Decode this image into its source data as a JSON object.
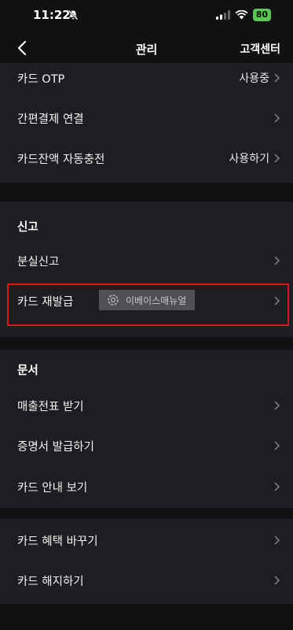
{
  "status": {
    "time": "11:22",
    "battery": "80"
  },
  "nav": {
    "title": "관리",
    "help": "고객센터"
  },
  "section1": [
    {
      "label": "카드 OTP",
      "value": "사용중"
    },
    {
      "label": "간편결제 연결",
      "value": ""
    },
    {
      "label": "카드잔액 자동충전",
      "value": "사용하기"
    }
  ],
  "report": {
    "title": "신고",
    "items": [
      {
        "label": "분실신고"
      },
      {
        "label": "카드 재발급"
      }
    ]
  },
  "documents": {
    "title": "문서",
    "items": [
      {
        "label": "매출전표 받기"
      },
      {
        "label": "증명서 발급하기"
      },
      {
        "label": "카드 안내 보기"
      }
    ]
  },
  "section4": [
    {
      "label": "카드 혜택 바꾸기"
    },
    {
      "label": "카드 해지하기"
    }
  ],
  "watermark": {
    "text": "이베이스매뉴얼"
  },
  "colors": {
    "highlight": "#e3141b",
    "section_bg": "#1e1e22",
    "page_bg": "#111114"
  }
}
